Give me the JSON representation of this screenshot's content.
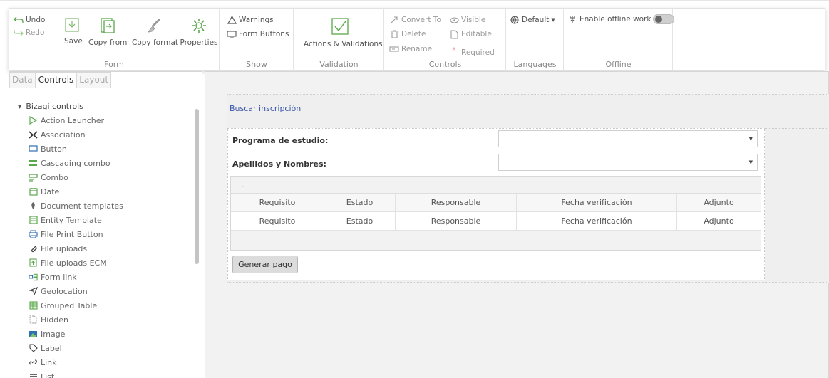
{
  "ribbon": {
    "form": {
      "undo": "Undo",
      "redo": "Redo",
      "save": "Save",
      "copy_from": "Copy from",
      "copy_format": "Copy format",
      "properties": "Properties",
      "label": "Form"
    },
    "show": {
      "warnings": "Warnings",
      "form_buttons": "Form Buttons",
      "label": "Show"
    },
    "validation": {
      "actions_validations": "Actions & Validations",
      "label": "Validation"
    },
    "controls": {
      "convert_to": "Convert To",
      "delete": "Delete",
      "rename": "Rename",
      "visible": "Visible",
      "editable": "Editable",
      "required": "Required",
      "label": "Controls"
    },
    "languages": {
      "default": "Default",
      "label": "Languages"
    },
    "offline": {
      "enable_offline": "Enable offline work",
      "label": "Offline"
    }
  },
  "left_panel": {
    "tabs": [
      "Data",
      "Controls",
      "Layout"
    ],
    "active_tab": "Controls",
    "tree_root": "Bizagi controls",
    "items": [
      {
        "label": "Action Launcher",
        "icon": "play-outline-icon"
      },
      {
        "label": "Association",
        "icon": "association-icon"
      },
      {
        "label": "Button",
        "icon": "button-icon"
      },
      {
        "label": "Cascading combo",
        "icon": "cascading-combo-icon"
      },
      {
        "label": "Combo",
        "icon": "combo-icon"
      },
      {
        "label": "Date",
        "icon": "calendar-icon"
      },
      {
        "label": "Document templates",
        "icon": "document-template-icon"
      },
      {
        "label": "Entity Template",
        "icon": "entity-template-icon"
      },
      {
        "label": "File Print Button",
        "icon": "printer-icon"
      },
      {
        "label": "File uploads",
        "icon": "paperclip-icon"
      },
      {
        "label": "File uploads ECM",
        "icon": "ecm-upload-icon"
      },
      {
        "label": "Form link",
        "icon": "form-link-icon"
      },
      {
        "label": "Geolocation",
        "icon": "location-arrow-icon"
      },
      {
        "label": "Grouped Table",
        "icon": "grouped-table-icon"
      },
      {
        "label": "Hidden",
        "icon": "hidden-icon"
      },
      {
        "label": "Image",
        "icon": "image-icon"
      },
      {
        "label": "Label",
        "icon": "tag-icon"
      },
      {
        "label": "Link",
        "icon": "link-icon"
      },
      {
        "label": "List",
        "icon": "list-icon"
      }
    ]
  },
  "canvas": {
    "link": "Buscar inscripción",
    "fields": [
      {
        "label": "Programa de estudio:",
        "value": ""
      },
      {
        "label": "Apellidos y Nombres:",
        "value": ""
      }
    ],
    "grid": {
      "toolbar_text": ".",
      "columns": [
        "Requisito",
        "Estado",
        "Responsable",
        "Fecha verificación",
        "Adjunto"
      ],
      "rows": [
        [
          "Requisito",
          "Estado",
          "Responsable",
          "Fecha verificación",
          "Adjunto"
        ]
      ]
    },
    "button": "Generar pago"
  },
  "colors": {
    "accent_green": "#5aa84c",
    "link_blue": "#3a55a8",
    "canvas_bg": "#f2f2f2"
  }
}
